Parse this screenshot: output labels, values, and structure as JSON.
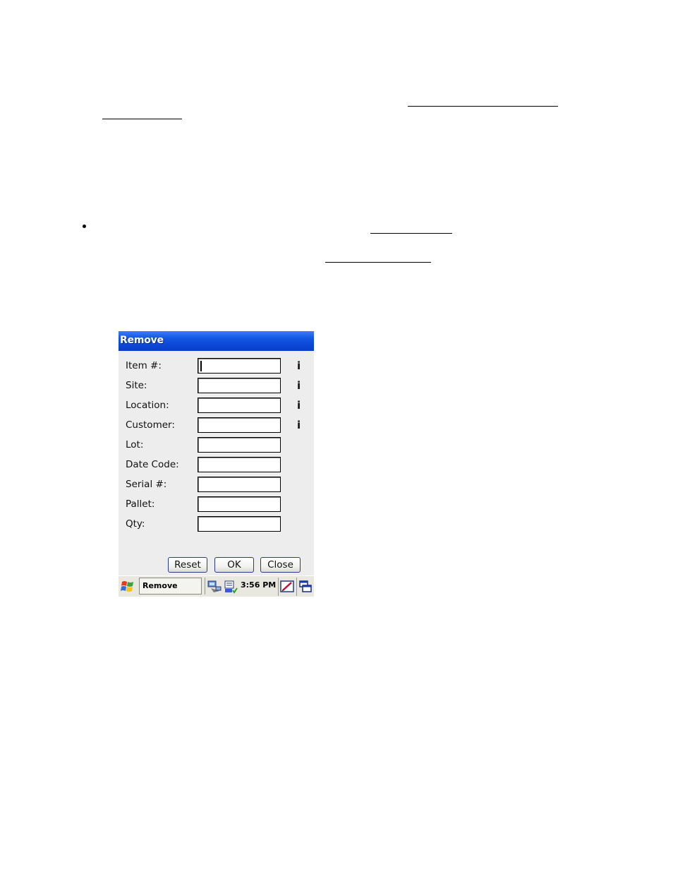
{
  "window": {
    "title": "Remove"
  },
  "form": {
    "fields": [
      {
        "label": "Item #:",
        "value": "",
        "has_info": true,
        "info_label": "i"
      },
      {
        "label": "Site:",
        "value": "",
        "has_info": true,
        "info_label": "i"
      },
      {
        "label": "Location:",
        "value": "",
        "has_info": true,
        "info_label": "i"
      },
      {
        "label": "Customer:",
        "value": "",
        "has_info": true,
        "info_label": "i"
      },
      {
        "label": "Lot:",
        "value": "",
        "has_info": false
      },
      {
        "label": "Date Code:",
        "value": "",
        "has_info": false
      },
      {
        "label": "Serial #:",
        "value": "",
        "has_info": false
      },
      {
        "label": "Pallet:",
        "value": "",
        "has_info": false
      },
      {
        "label": "Qty:",
        "value": "",
        "has_info": false
      }
    ]
  },
  "buttons": {
    "reset": "Reset",
    "ok": "OK",
    "close": "Close"
  },
  "taskbar": {
    "active_task": "Remove",
    "clock": "3:56 PM"
  },
  "icons": {
    "start": "windows-flag-icon",
    "network": "network-icon",
    "keyboard": "keyboard-icon",
    "input_panel": "input-panel-icon",
    "desktop": "show-desktop-icon"
  },
  "colors": {
    "titlebar": "#0b47d6",
    "form_background": "#ededed",
    "taskbar": "#e8e8e0"
  }
}
